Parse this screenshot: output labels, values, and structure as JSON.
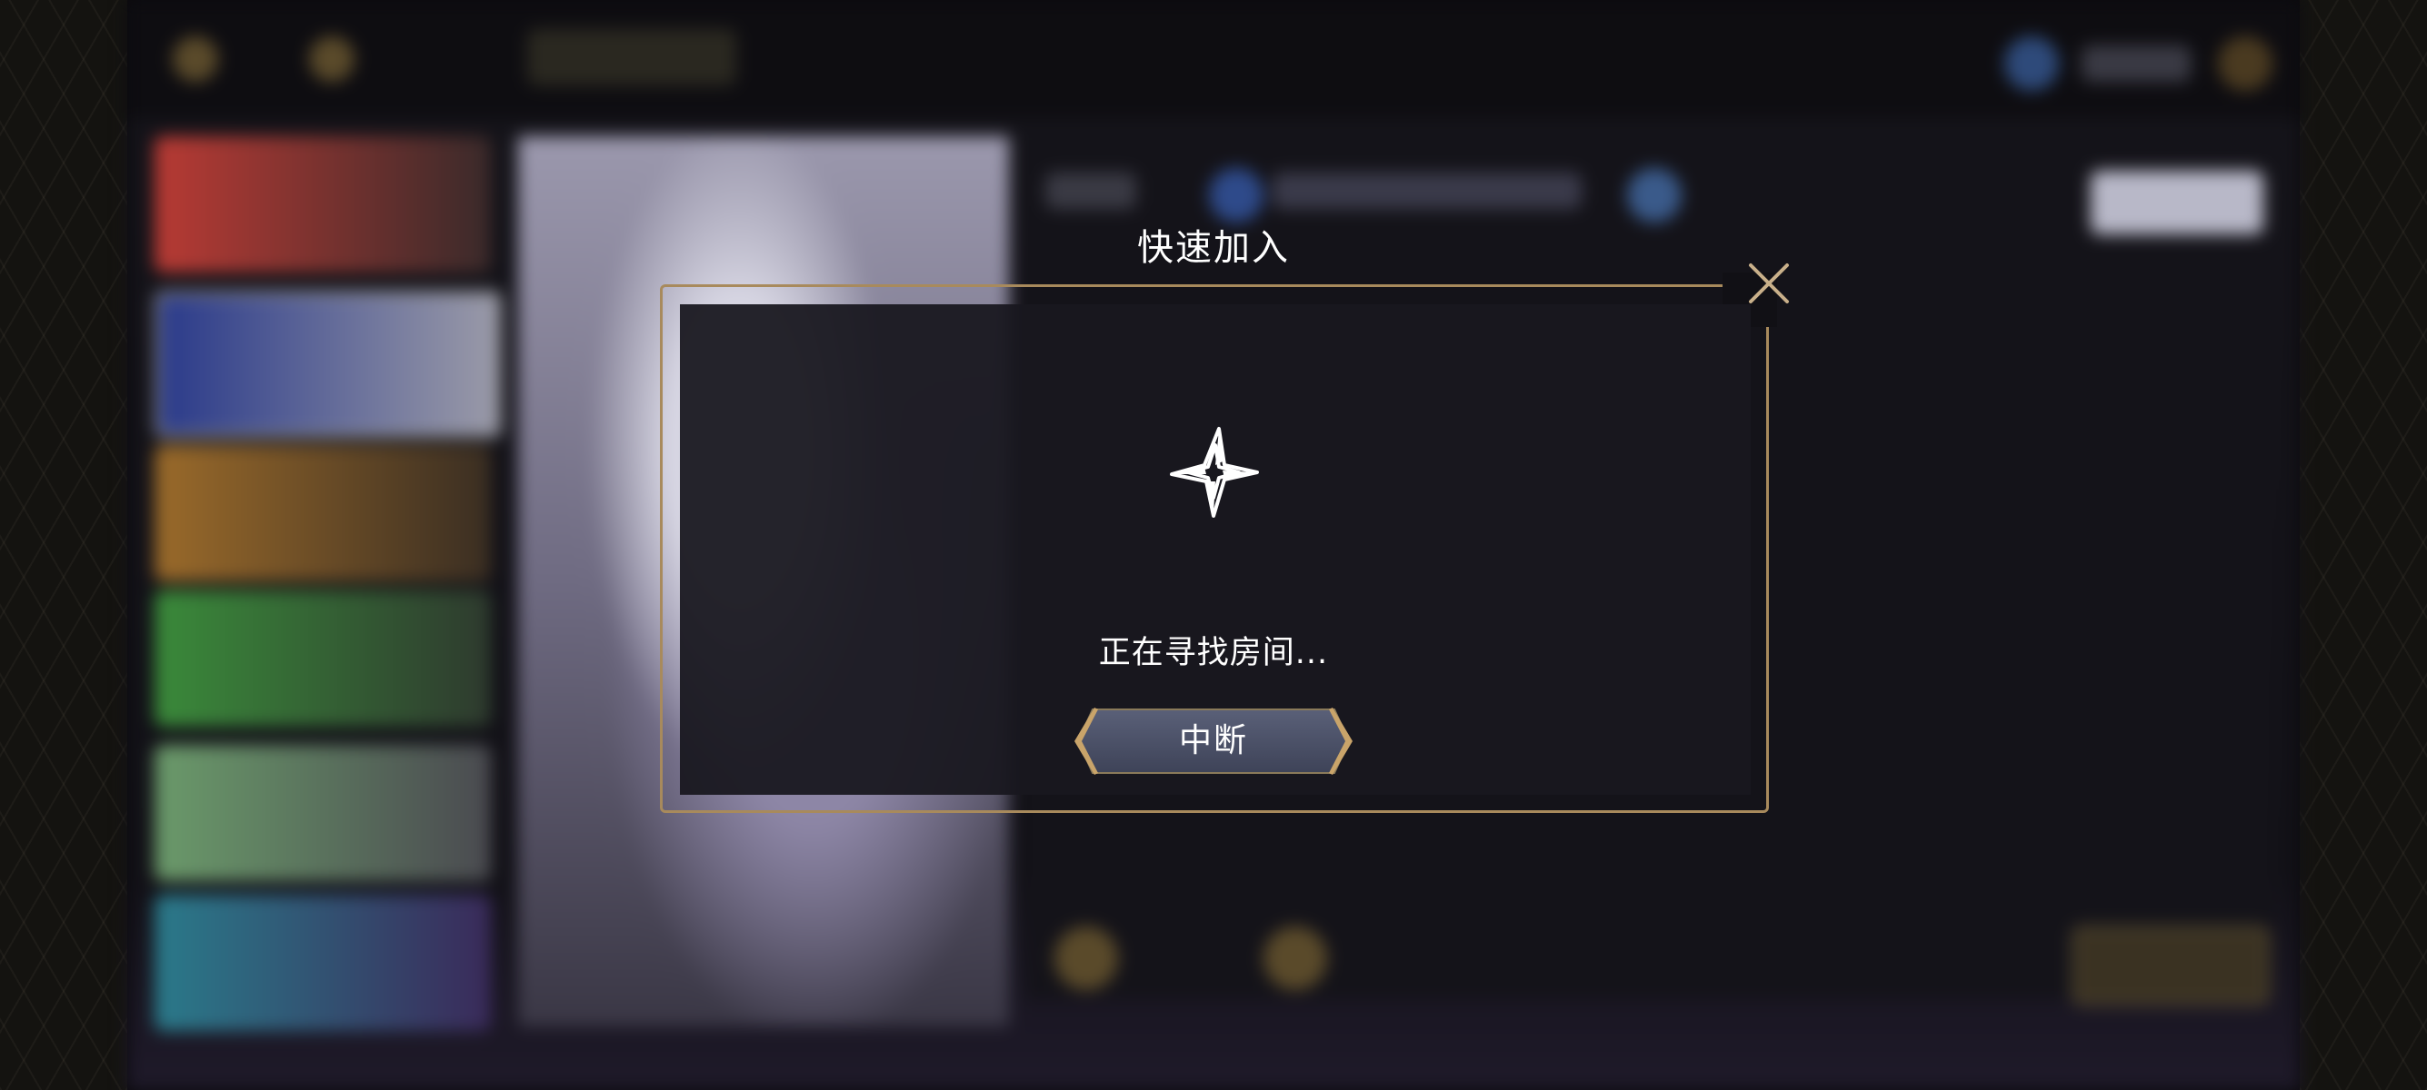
{
  "dialog": {
    "title": "快速加入",
    "status": "正在寻找房间...",
    "abort_label": "中断",
    "close_icon": "close-icon",
    "spinner_icon": "four-point-star-spinner-icon"
  },
  "colors": {
    "frame_gold": "#a88a5c",
    "dialog_bg": "#18171f",
    "button_bg": "#4a5068",
    "text": "#ffffff"
  }
}
